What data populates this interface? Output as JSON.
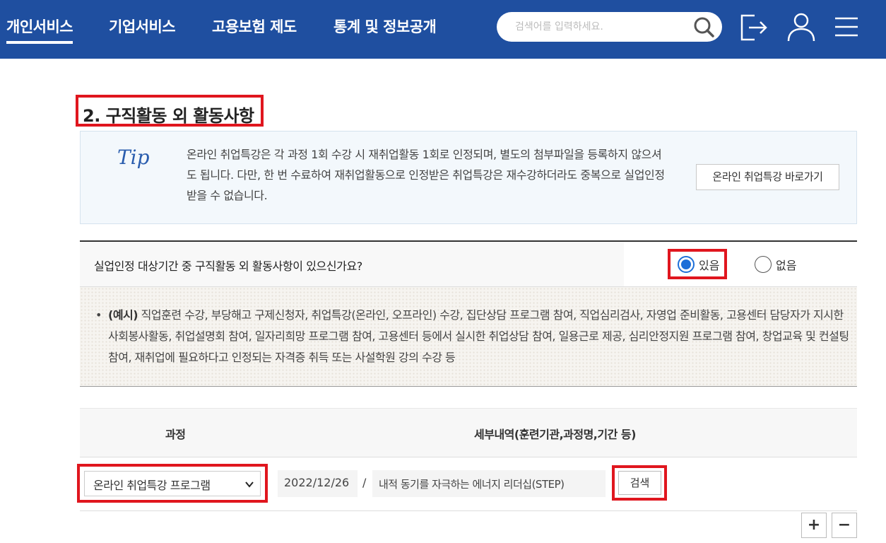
{
  "nav": {
    "items": [
      {
        "label": "개인서비스"
      },
      {
        "label": "기업서비스"
      },
      {
        "label": "고용보험 제도"
      },
      {
        "label": "통계 및 정보공개"
      }
    ]
  },
  "search": {
    "placeholder": "검색어를 입력하세요."
  },
  "header_icons": [
    "search-icon",
    "logout-icon",
    "user-icon",
    "menu-icon"
  ],
  "section": {
    "title": "2. 구직활동 외 활동사항"
  },
  "tip": {
    "label": "Tip",
    "text": "온라인 취업특강은 각 과정 1회 수강 시 재취업활동 1회로 인정되며, 별도의 첨부파일을 등록하지 않으셔도 됩니다. 다만, 한 번 수료하여 재취업활동으로 인정받은 취업특강은 재수강하더라도 중복으로 실업인정 받을 수 없습니다.",
    "button": "온라인 취업특강 바로가기"
  },
  "question": {
    "text": "실업인정 대상기간 중 구직활동 외 활동사항이 있으신가요?",
    "options": [
      {
        "label": "있음",
        "checked": true
      },
      {
        "label": "없음",
        "checked": false
      }
    ]
  },
  "example": {
    "bullet": "•",
    "prefix": "(예시)",
    "text": " 직업훈련 수강, 부당해고 구제신청자, 취업특강(온라인, 오프라인) 수강, 집단상담 프로그램 참여, 직업심리검사, 자영업 준비활동, 고용센터 담당자가 지시한 사회봉사활동, 취업설명회 참여, 일자리희망 프로그램 참여, 고용센터 등에서 실시한 취업상담 참여, 일용근로 제공, 심리안정지원 프로그램 참여, 창업교육 및 컨설팅 참여, 재취업에 필요하다고 인정되는 자격증 취득 또는 사설학원 강의 수강 등"
  },
  "table": {
    "headers": [
      "과정",
      "세부내역(훈련기관,과정명,기간 등)"
    ],
    "row": {
      "course": "온라인 취업특강 프로그램",
      "date": "2022/12/26",
      "separator": "/",
      "detail": "내적 동기를 자극하는 에너지 리더십(STEP)",
      "search_button": "검색"
    },
    "add_label": "+",
    "remove_label": "−"
  },
  "colors": {
    "header_bg": "#1f4fa0",
    "highlight": "#e0161e",
    "radio_accent": "#1d6fd8"
  }
}
